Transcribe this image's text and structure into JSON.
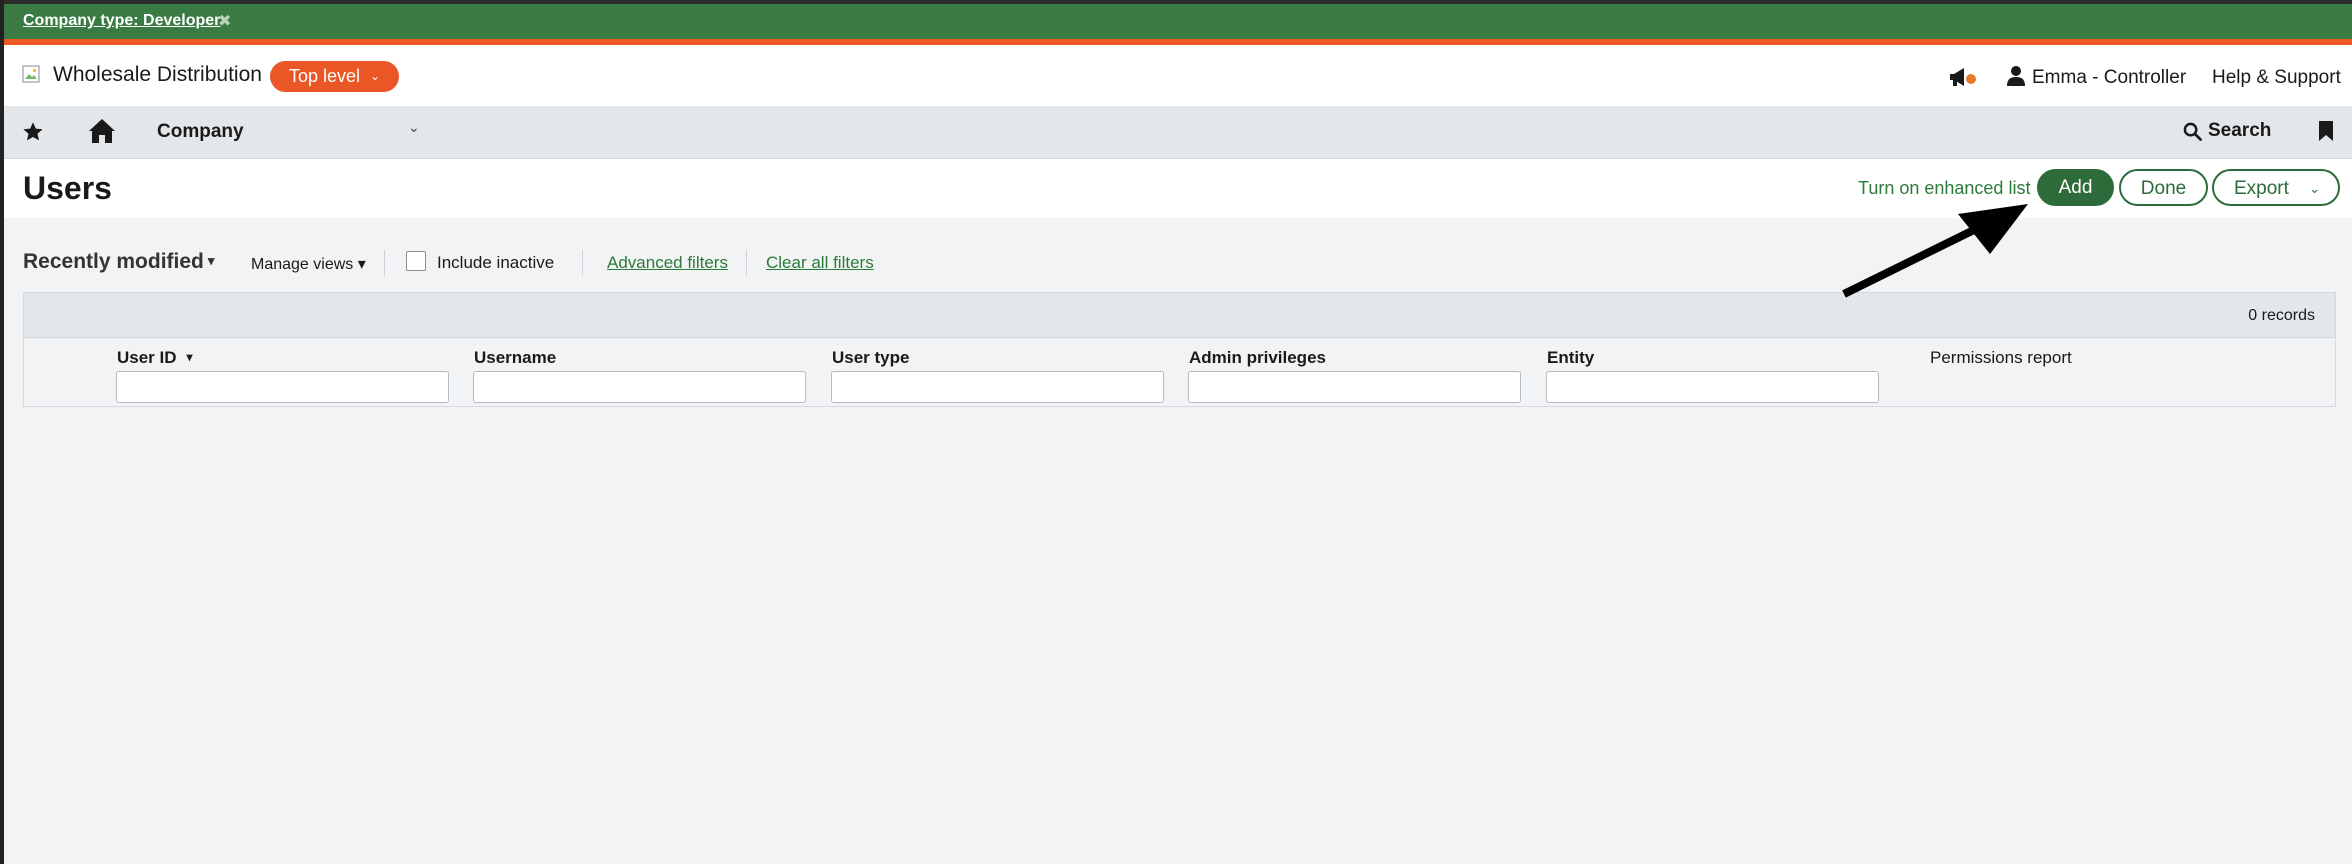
{
  "banner": {
    "company_type_link": "Company type: Developer",
    "close_glyph": "✖"
  },
  "header": {
    "company_name": "Wholesale Distribution",
    "level_label": "Top level",
    "level_chevron": "⌄",
    "user_label": "Emma - Controller",
    "help_label": "Help & Support",
    "colors": {
      "accent_orange": "#ea5626",
      "brand_green": "#3a7a43"
    }
  },
  "nav": {
    "company_label": "Company",
    "chevron": "⌄",
    "search_label": "Search",
    "icons": [
      "star-icon",
      "home-icon",
      "search-icon",
      "bookmark-icon"
    ]
  },
  "page": {
    "title": "Users",
    "enhanced_link": "Turn on enhanced list",
    "add_label": "Add",
    "done_label": "Done",
    "export_label": "Export",
    "export_chevron": "⌄"
  },
  "filters": {
    "view_name": "Recently modified",
    "view_caret": "▾",
    "manage_views": "Manage views ▾",
    "include_inactive": "Include inactive",
    "advanced_filters": "Advanced filters",
    "clear_filters": "Clear all filters"
  },
  "table": {
    "record_count": "0 records",
    "sort_caret": "▾",
    "columns": [
      {
        "label": "User ID"
      },
      {
        "label": "Username"
      },
      {
        "label": "User type"
      },
      {
        "label": "Admin privileges"
      },
      {
        "label": "Entity"
      },
      {
        "label": "Permissions report"
      }
    ],
    "filter_values": [
      "",
      "",
      "",
      "",
      ""
    ]
  }
}
